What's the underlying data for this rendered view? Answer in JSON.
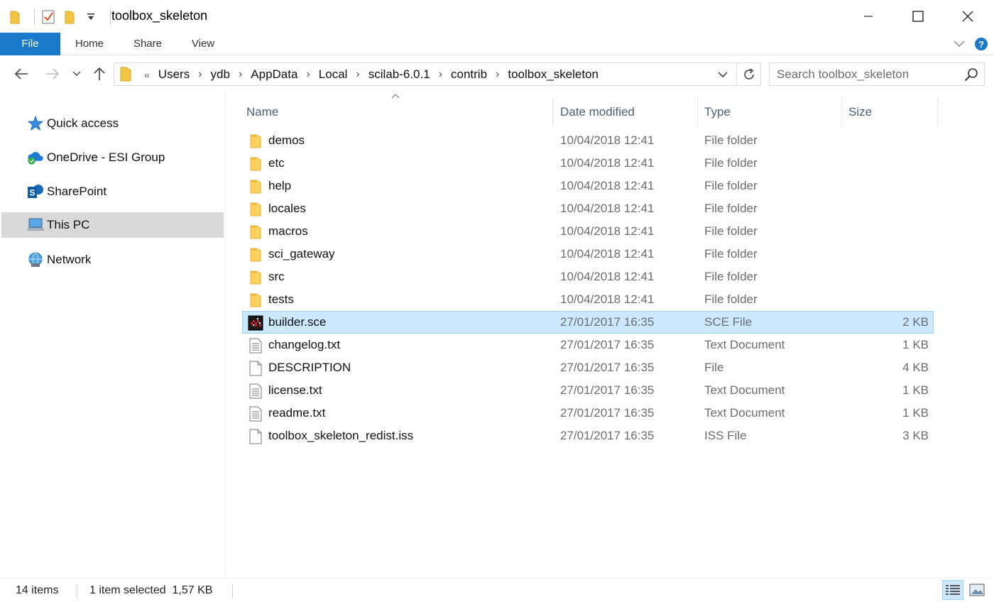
{
  "window": {
    "title": "toolbox_skeleton"
  },
  "ribbon": {
    "tabs": [
      "File",
      "Home",
      "Share",
      "View"
    ]
  },
  "address": {
    "overflow": "«",
    "crumbs": [
      "Users",
      "ydb",
      "AppData",
      "Local",
      "scilab-6.0.1",
      "contrib",
      "toolbox_skeleton"
    ],
    "separator": "›"
  },
  "search": {
    "placeholder": "Search toolbox_skeleton"
  },
  "navpane": {
    "items": [
      {
        "label": "Quick access",
        "icon": "star-icon"
      },
      {
        "label": "OneDrive - ESI Group",
        "icon": "onedrive-cloud-icon"
      },
      {
        "label": "SharePoint",
        "icon": "sharepoint-icon"
      },
      {
        "label": "This PC",
        "icon": "computer-icon"
      },
      {
        "label": "Network",
        "icon": "network-icon"
      }
    ]
  },
  "columns": {
    "name": "Name",
    "date": "Date modified",
    "type": "Type",
    "size": "Size"
  },
  "files": [
    {
      "name": "demos",
      "date": "10/04/2018 12:41",
      "type": "File folder",
      "size": "",
      "icon": "folder"
    },
    {
      "name": "etc",
      "date": "10/04/2018 12:41",
      "type": "File folder",
      "size": "",
      "icon": "folder"
    },
    {
      "name": "help",
      "date": "10/04/2018 12:41",
      "type": "File folder",
      "size": "",
      "icon": "folder"
    },
    {
      "name": "locales",
      "date": "10/04/2018 12:41",
      "type": "File folder",
      "size": "",
      "icon": "folder"
    },
    {
      "name": "macros",
      "date": "10/04/2018 12:41",
      "type": "File folder",
      "size": "",
      "icon": "folder"
    },
    {
      "name": "sci_gateway",
      "date": "10/04/2018 12:41",
      "type": "File folder",
      "size": "",
      "icon": "folder"
    },
    {
      "name": "src",
      "date": "10/04/2018 12:41",
      "type": "File folder",
      "size": "",
      "icon": "folder"
    },
    {
      "name": "tests",
      "date": "10/04/2018 12:41",
      "type": "File folder",
      "size": "",
      "icon": "folder"
    },
    {
      "name": "builder.sce",
      "date": "27/01/2017 16:35",
      "type": "SCE File",
      "size": "2 KB",
      "icon": "scilab"
    },
    {
      "name": "changelog.txt",
      "date": "27/01/2017 16:35",
      "type": "Text Document",
      "size": "1 KB",
      "icon": "text"
    },
    {
      "name": "DESCRIPTION",
      "date": "27/01/2017 16:35",
      "type": "File",
      "size": "4 KB",
      "icon": "blank"
    },
    {
      "name": "license.txt",
      "date": "27/01/2017 16:35",
      "type": "Text Document",
      "size": "1 KB",
      "icon": "text"
    },
    {
      "name": "readme.txt",
      "date": "27/01/2017 16:35",
      "type": "Text Document",
      "size": "1 KB",
      "icon": "text"
    },
    {
      "name": "toolbox_skeleton_redist.iss",
      "date": "27/01/2017 16:35",
      "type": "ISS File",
      "size": "3 KB",
      "icon": "blank"
    }
  ],
  "selected_index": 8,
  "status": {
    "item_count": "14 items",
    "selection": "1 item selected  1,57 KB"
  },
  "colors": {
    "accent": "#1979ca",
    "selection_bg": "#cce8ff",
    "selection_border": "#99d1ff",
    "folder": "#ffd15f"
  }
}
